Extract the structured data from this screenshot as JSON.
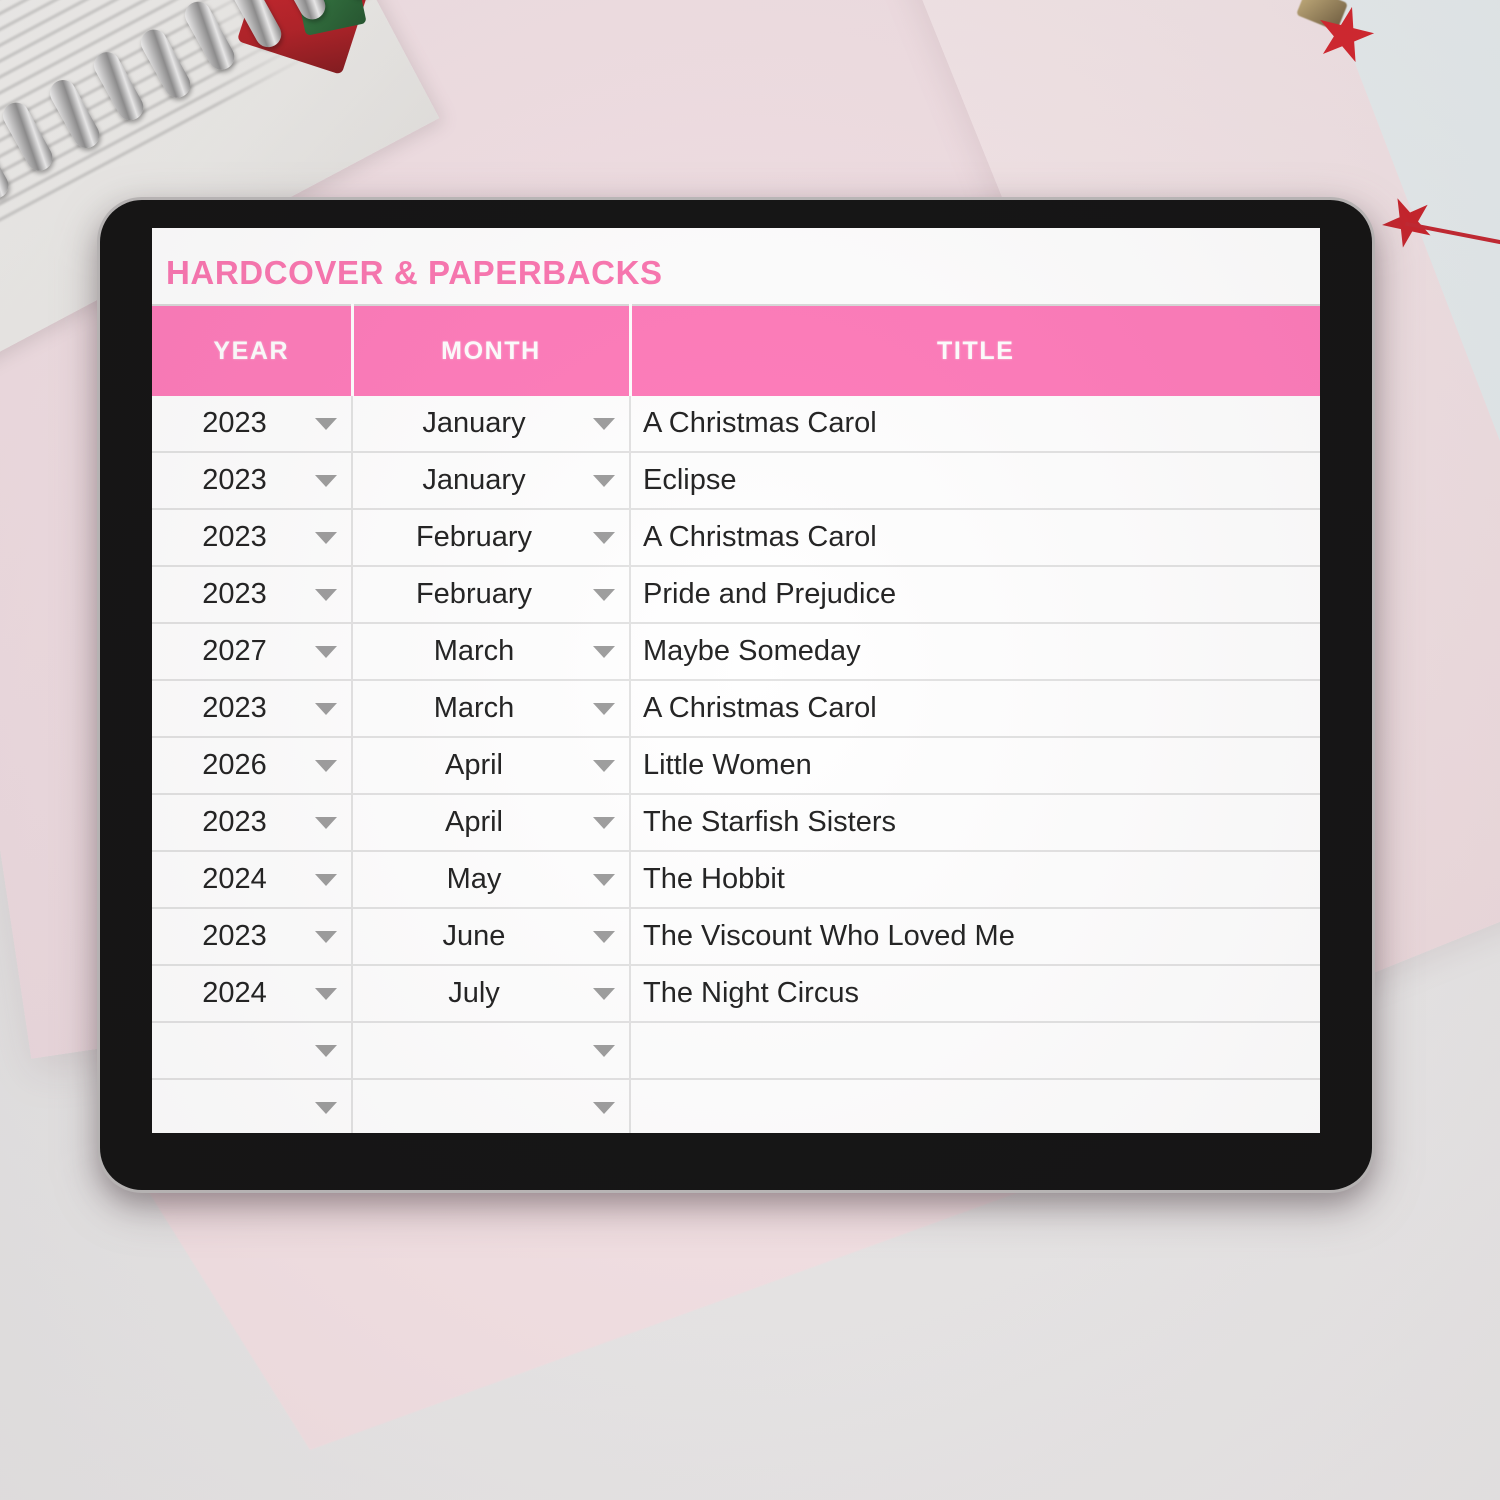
{
  "sheet": {
    "title": "HARDCOVER & PAPERBACKS",
    "accent_color": "#ff77b8",
    "title_color": "#fb72ae",
    "columns": [
      "YEAR",
      "MONTH",
      "TITLE"
    ],
    "rows": [
      {
        "year": "2023",
        "month": "January",
        "title": "A Christmas Carol"
      },
      {
        "year": "2023",
        "month": "January",
        "title": "Eclipse"
      },
      {
        "year": "2023",
        "month": "February",
        "title": "A Christmas Carol"
      },
      {
        "year": "2023",
        "month": "February",
        "title": "Pride and Prejudice"
      },
      {
        "year": "2027",
        "month": "March",
        "title": "Maybe Someday"
      },
      {
        "year": "2023",
        "month": "March",
        "title": "A Christmas Carol"
      },
      {
        "year": "2026",
        "month": "April",
        "title": "Little Women"
      },
      {
        "year": "2023",
        "month": "April",
        "title": "The Starfish Sisters"
      },
      {
        "year": "2024",
        "month": "May",
        "title": "The Hobbit"
      },
      {
        "year": "2023",
        "month": "June",
        "title": "The Viscount Who Loved Me"
      },
      {
        "year": "2024",
        "month": "July",
        "title": "The Night Circus"
      },
      {
        "year": "",
        "month": "",
        "title": ""
      },
      {
        "year": "",
        "month": "",
        "title": ""
      },
      {
        "year": "",
        "month": "",
        "title": ""
      }
    ]
  }
}
